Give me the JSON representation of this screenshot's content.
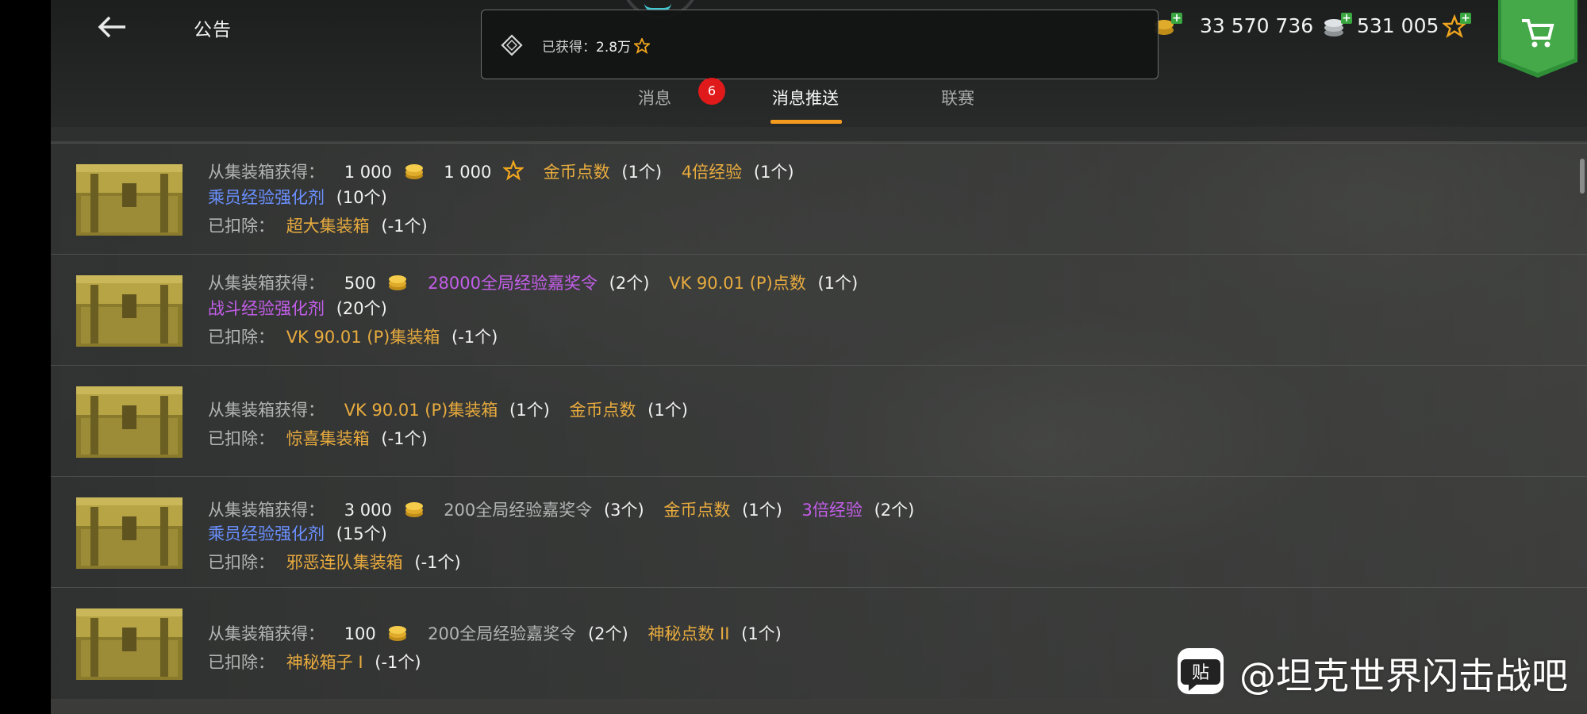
{
  "header": {
    "title": "公告",
    "popup": {
      "label": "已获得：",
      "value": "2.8万"
    },
    "currencies": [
      {
        "value": "33 570 736",
        "icon": "silver-coins-icon"
      },
      {
        "value": "531 005",
        "icon": "star-experience-icon"
      }
    ],
    "badge_count": "6"
  },
  "tabs": [
    {
      "label": "消息"
    },
    {
      "label": "消息推送",
      "active": true
    },
    {
      "label": "联赛"
    }
  ],
  "rows": [
    {
      "line1": {
        "prefix": "从集装箱获得：",
        "a": "1 000",
        "b": "1 000",
        "c": "金币点数",
        "c_q": "(1个)",
        "d": "4倍经验",
        "d_q": "(1个)"
      },
      "line2": {
        "name": "乘员经验强化剂",
        "q": "(10个)"
      },
      "line3": {
        "prefix": "已扣除：",
        "name": "超大集装箱",
        "q": "(-1个)"
      }
    },
    {
      "line1": {
        "prefix": "从集装箱获得：",
        "a": "500",
        "b": "28000全局经验嘉奖令",
        "b_q": "(2个)",
        "c": "VK 90.01 (P)点数",
        "c_q": "(1个)"
      },
      "line2": {
        "name": "战斗经验强化剂",
        "q": "(20个)"
      },
      "line3": {
        "prefix": "已扣除：",
        "name": "VK 90.01 (P)集装箱",
        "q": "(-1个)"
      }
    },
    {
      "line1": {
        "prefix": "从集装箱获得：",
        "a": "VK 90.01 (P)集装箱",
        "a_q": "(1个)",
        "b": "金币点数",
        "b_q": "(1个)"
      },
      "line3": {
        "prefix": "已扣除：",
        "name": "惊喜集装箱",
        "q": "(-1个)"
      }
    },
    {
      "line1": {
        "prefix": "从集装箱获得：",
        "a": "3 000",
        "b": "200全局经验嘉奖令",
        "b_q": "(3个)",
        "c": "金币点数",
        "c_q": "(1个)",
        "d": "3倍经验",
        "d_q": "(2个)"
      },
      "line2": {
        "name": "乘员经验强化剂",
        "q": "(15个)"
      },
      "line3": {
        "prefix": "已扣除：",
        "name": "邪恶连队集装箱",
        "q": "(-1个)"
      }
    },
    {
      "line1": {
        "prefix": "从集装箱获得：",
        "a": "100",
        "b": "200全局经验嘉奖令",
        "b_q": "(2个)",
        "c": "神秘点数 II",
        "c_q": "(1个)"
      },
      "line3": {
        "prefix": "已扣除：",
        "name": "神秘箱子 I",
        "q": "(-1个)"
      }
    }
  ],
  "watermark": {
    "text": "@坦克世界闪击战吧",
    "logo_glyph": "贴"
  },
  "colors": {
    "tab_underline": "#f39a1f",
    "badge": "#e01a1a",
    "gold_item": "#e8ab3e",
    "blue_item": "#6a90ff",
    "purple_item": "#c35ee9",
    "shop": "#3aa640"
  }
}
